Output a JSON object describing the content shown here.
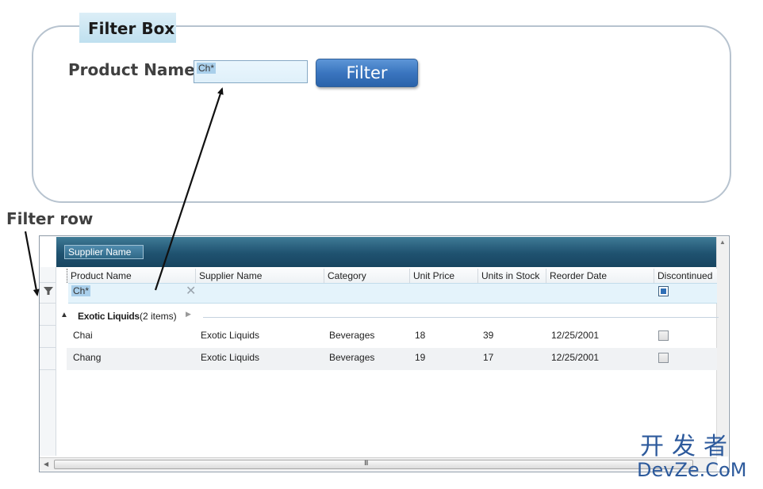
{
  "filter_box": {
    "title": "Filter Box",
    "product_label": "Product Name",
    "input_value": "Ch*",
    "button_label": "Filter"
  },
  "filter_row_caption": "Filter row",
  "grid": {
    "group_panel_chip": "Supplier Name",
    "columns": [
      "Product Name",
      "Supplier Name",
      "Category",
      "Unit Price",
      "Units in Stock",
      "Reorder Date",
      "Discontinued"
    ],
    "filter_row": {
      "product_name": "Ch*",
      "discontinued_checked": true
    },
    "group": {
      "name": "Exotic Liquids",
      "count_text": "(2 items)"
    },
    "rows": [
      {
        "product_name": "Chai",
        "supplier_name": "Exotic Liquids",
        "category": "Beverages",
        "unit_price": "18",
        "units_in_stock": "39",
        "reorder_date": "12/25/2001",
        "discontinued": false
      },
      {
        "product_name": "Chang",
        "supplier_name": "Exotic Liquids",
        "category": "Beverages",
        "unit_price": "19",
        "units_in_stock": "17",
        "reorder_date": "12/25/2001",
        "discontinued": false
      }
    ],
    "scroll_grip": "III"
  },
  "watermark": {
    "chinese": "开发者",
    "latin": "DevZe.CoM"
  },
  "icons": {
    "filter_row_indicator": "funnel-icon",
    "clear_filter": "close-icon",
    "group_collapse": "caret-up-icon",
    "group_expand": "caret-right-icon"
  },
  "colors": {
    "button_blue": "#3a75bf",
    "group_panel_teal": "#1f5270",
    "filter_row_bg": "#e4f3fb",
    "panel_border": "#b7c3cf"
  }
}
